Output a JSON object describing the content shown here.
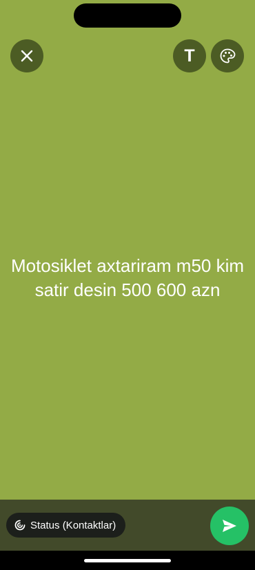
{
  "top_bar": {
    "close_icon": "close-icon",
    "text_tool_label": "T",
    "palette_icon": "palette-icon"
  },
  "status": {
    "text": "Motosiklet axtariram m50 kim satir desin 500 600 azn",
    "background_color": "#93ab46",
    "text_color": "#ffffff"
  },
  "bottom_bar": {
    "privacy_label": "Status (Kontaktlar)",
    "privacy_icon": "status-privacy-icon",
    "send_icon": "send-icon",
    "send_color": "#25c166"
  }
}
